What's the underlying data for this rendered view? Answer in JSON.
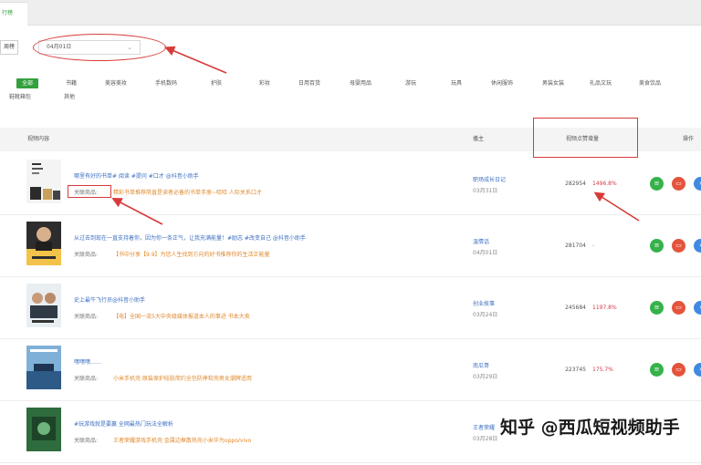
{
  "tabs": {
    "active_label": "行榜"
  },
  "filters": {
    "period_label": "周榜",
    "date_value": "04月01日"
  },
  "categories": [
    "全部",
    "书籍",
    "美容美妆",
    "手机数码",
    "护肤",
    "彩妆",
    "日用百货",
    "母婴用品",
    "游玩",
    "玩具",
    "休闲服饰",
    "男装女装",
    "礼品文玩",
    "美食饮品",
    "鞋靴箱包",
    "其他"
  ],
  "table": {
    "headers": {
      "content": "视频内容",
      "author": "播主",
      "views": "视频点赞增量",
      "actions": "操作"
    },
    "product_label": "关联商品:",
    "rows": [
      {
        "title": "哪里有好的书单# 阅读 #提问 #口才 @抖音小助手",
        "product": "精彩书单推荐简直是读者必备的书单手册~哈哈  人际关系口才",
        "author": "职场成长日记",
        "date": "03月31日",
        "views": "282954",
        "growth": "1496.8%"
      },
      {
        "title": "从过去到现在一直支持着你，因为你一条正气，让我充满能量！#励志 #改变自己 @抖音小助手",
        "product": "【书中分享【9.9】为您人生找到方向的好书推荐你的生活正能量",
        "author": "温情话",
        "date": "04月01日",
        "views": "281704",
        "growth": "-"
      },
      {
        "title": "史上最牛飞行员@抖音小助手",
        "product": "【电】全国一流5大中央级媒体报道本人的事迹 书本大卖",
        "author": "创业故事",
        "date": "03月24日",
        "views": "245684",
        "growth": "1197.8%"
      },
      {
        "title": "嘿嘿嘿……",
        "product": "小米手机壳 原装保护硅胶简约全包防摔软壳男女潮牌适用",
        "author": "南瓜哥",
        "date": "03月29日",
        "views": "223745",
        "growth": "175.7%"
      },
      {
        "title": "#玩游戏就是要赢 全网最热门玩法全解析",
        "product": "王者荣耀游戏手机壳 金属边框散热壳小米华为oppo/vivo",
        "author": "王者荣耀",
        "date": "03月28日",
        "views": "",
        "growth": ""
      }
    ]
  },
  "actions": {
    "green_icon": "comment-icon",
    "red_icon": "cart-icon",
    "blue_icon": "more-icon"
  },
  "watermark": "知乎 @西瓜短视频助手",
  "colors": {
    "accent": "#33a03e",
    "link": "#3c6fc2",
    "product": "#e08a2e",
    "growth": "#d23a4e",
    "annotation": "#d83a3a"
  }
}
